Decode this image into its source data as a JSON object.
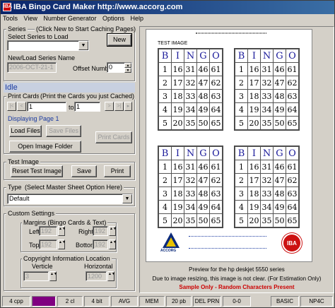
{
  "window": {
    "title": "IBA Bingo Card Maker  http://www.accorg.com",
    "icon_text": "IBA"
  },
  "menu": [
    "Tools",
    "View",
    "Number Generator",
    "Options",
    "Help"
  ],
  "series": {
    "group_label": "Series",
    "hint": "(Click New to Start Caching Pages)",
    "select_label": "Select Series to Load",
    "select_value": "",
    "new_button": "New",
    "name_label": "New/Load Series Name",
    "name_value": "2006-OCT-21-1",
    "offset_label": "Offset Number",
    "offset_value": "0"
  },
  "status_text": "Idle",
  "print_cards": {
    "group_label": "Print Cards",
    "hint": "(Print the Cards you just Cached)",
    "nav_first": "|<",
    "nav_prev": "<",
    "nav_next": ">",
    "nav_last": ">|",
    "from_value": "1",
    "to_label": "to",
    "to_value": "1",
    "displaying": "Displaying Page 1",
    "load_files": "Load Files",
    "save_files": "Save Files",
    "print_cards_btn": "Print Cards",
    "open_image_folder": "Open Image Folder"
  },
  "test_image": {
    "group_label": "Test Image",
    "reset": "Reset Test Image",
    "save": "Save",
    "print": "Print"
  },
  "type": {
    "group_label": "Type",
    "hint": "(Select Master Sheet Option Here)",
    "value": "Default"
  },
  "custom": {
    "group_label": "Custom Settings",
    "margins_label": "Margins (Bingo Cards  & Text)",
    "left_label": "Left",
    "left_value": "192",
    "right_label": "Right",
    "right_value": "192",
    "top_label": "Top",
    "top_value": "192",
    "bottom_label": "Bottom",
    "bottom_value": "192",
    "copyright_label": "Copyright Information Location",
    "verticle_label": "Verticle",
    "verticle_value": "3",
    "horizontal_label": "Horizontal",
    "horizontal_value": "1200"
  },
  "preview": {
    "sheet_title": "TEST IMAGE",
    "header_letters": [
      "B",
      "I",
      "N",
      "G",
      "O"
    ],
    "card_left": [
      [
        "1",
        "16",
        "31",
        "46",
        "61"
      ],
      [
        "2",
        "17",
        "32",
        "47",
        "62"
      ],
      [
        "3",
        "18",
        "33",
        "48",
        "63"
      ],
      [
        "4",
        "19",
        "34",
        "49",
        "64"
      ],
      [
        "5",
        "20",
        "35",
        "50",
        "65"
      ]
    ],
    "card_right": [
      [
        "1",
        "16",
        "31",
        "46",
        "61"
      ],
      [
        "2",
        "17",
        "32",
        "47",
        "62"
      ],
      [
        "3",
        "18",
        "33",
        "48",
        "63"
      ],
      [
        "4",
        "19",
        "34",
        "49",
        "64"
      ],
      [
        "5",
        "20",
        "35",
        "50",
        "65"
      ]
    ],
    "logo_left": "ACCORG",
    "logo_right": "IBA",
    "caption1": "Preview for the hp deskjet 5550 series",
    "caption2": "Due to image resizing, this image is not clear.  (For Estimation Only)",
    "caption3": "Sample Only - Random Characters Present",
    "caption3_color": "#cc0000"
  },
  "statusbar": [
    "4 cpp",
    "",
    "2 cl",
    "4 bit",
    "AVG",
    "MEM",
    "20 pb",
    "DEL PRN",
    "0-0",
    "BASIC",
    "NP4C"
  ],
  "statusbar_swatch_color": "#800080"
}
